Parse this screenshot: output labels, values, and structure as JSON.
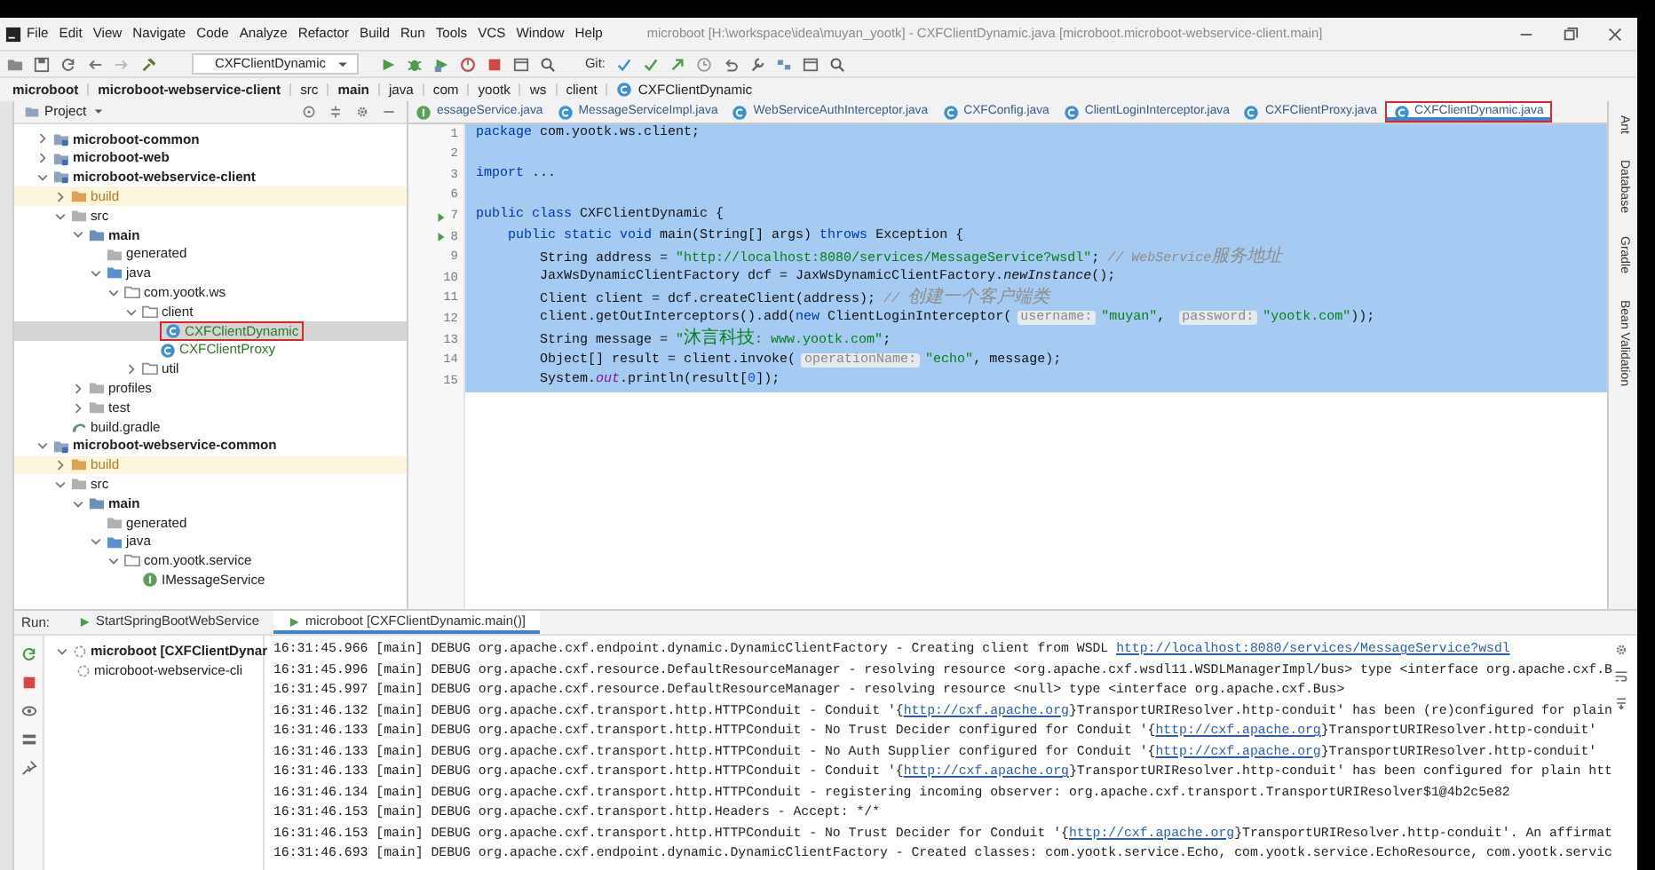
{
  "window": {
    "title": "microboot [H:\\workspace\\idea\\muyan_yootk] - CXFClientDynamic.java [microboot.microboot-webservice-client.main]"
  },
  "menu": [
    "File",
    "Edit",
    "View",
    "Navigate",
    "Code",
    "Analyze",
    "Refactor",
    "Build",
    "Run",
    "Tools",
    "VCS",
    "Window",
    "Help"
  ],
  "toolbar": {
    "run_configuration": "CXFClientDynamic",
    "git_label": "Git:"
  },
  "breadcrumb": [
    {
      "label": "microboot",
      "kind": "module"
    },
    {
      "label": "microboot-webservice-client",
      "kind": "module"
    },
    {
      "label": "src",
      "kind": "folder"
    },
    {
      "label": "main",
      "kind": "module"
    },
    {
      "label": "java",
      "kind": "folder"
    },
    {
      "label": "com",
      "kind": "folder"
    },
    {
      "label": "yootk",
      "kind": "folder"
    },
    {
      "label": "ws",
      "kind": "folder"
    },
    {
      "label": "client",
      "kind": "folder"
    },
    {
      "label": "CXFClientDynamic",
      "kind": "class"
    }
  ],
  "project_panel": {
    "title": "Project",
    "tree": [
      {
        "label": "microboot-common",
        "kind": "module",
        "expanded": false,
        "selected": false
      },
      {
        "label": "microboot-web",
        "kind": "module",
        "expanded": false,
        "selected": false
      },
      {
        "label": "microboot-webservice-client",
        "kind": "module",
        "expanded": true,
        "selected": false,
        "children": [
          {
            "label": "build",
            "kind": "excluded",
            "expanded": false,
            "selected": false
          },
          {
            "label": "src",
            "kind": "folder",
            "expanded": true,
            "selected": false,
            "children": [
              {
                "label": "main",
                "kind": "source-root",
                "expanded": true,
                "selected": false,
                "children": [
                  {
                    "label": "generated",
                    "kind": "folder",
                    "selected": false
                  },
                  {
                    "label": "java",
                    "kind": "source-folder",
                    "expanded": true,
                    "selected": false,
                    "children": [
                      {
                        "label": "com.yootk.ws",
                        "kind": "package",
                        "expanded": true,
                        "selected": false,
                        "children": [
                          {
                            "label": "client",
                            "kind": "package",
                            "expanded": true,
                            "selected": false,
                            "children": [
                              {
                                "label": "CXFClientDynamic",
                                "kind": "class",
                                "selected": true,
                                "highlighted": true
                              },
                              {
                                "label": "CXFClientProxy",
                                "kind": "class",
                                "selected": false
                              }
                            ]
                          },
                          {
                            "label": "util",
                            "kind": "package",
                            "expanded": false,
                            "selected": false
                          }
                        ]
                      }
                    ]
                  }
                ]
              },
              {
                "label": "profiles",
                "kind": "folder",
                "expanded": false,
                "selected": false
              },
              {
                "label": "test",
                "kind": "folder",
                "expanded": false,
                "selected": false
              }
            ]
          },
          {
            "label": "build.gradle",
            "kind": "gradle",
            "selected": false
          }
        ]
      },
      {
        "label": "microboot-webservice-common",
        "kind": "module",
        "expanded": true,
        "selected": false,
        "children": [
          {
            "label": "build",
            "kind": "excluded",
            "expanded": false,
            "selected": false
          },
          {
            "label": "src",
            "kind": "folder",
            "expanded": true,
            "selected": false,
            "children": [
              {
                "label": "main",
                "kind": "source-root",
                "expanded": true,
                "selected": false,
                "children": [
                  {
                    "label": "generated",
                    "kind": "folder",
                    "selected": false
                  },
                  {
                    "label": "java",
                    "kind": "source-folder",
                    "expanded": true,
                    "selected": false,
                    "children": [
                      {
                        "label": "com.yootk.service",
                        "kind": "package",
                        "expanded": true,
                        "selected": false,
                        "children": [
                          {
                            "label": "IMessageService",
                            "kind": "interface",
                            "selected": false
                          }
                        ]
                      }
                    ]
                  }
                ]
              }
            ]
          }
        ]
      }
    ]
  },
  "editor": {
    "tabs": [
      {
        "label": "essageService.java",
        "kind": "interface",
        "selected": false
      },
      {
        "label": "MessageServiceImpl.java",
        "kind": "class",
        "selected": false
      },
      {
        "label": "WebServiceAuthInterceptor.java",
        "kind": "class",
        "selected": false
      },
      {
        "label": "CXFConfig.java",
        "kind": "class",
        "selected": false
      },
      {
        "label": "ClientLoginInterceptor.java",
        "kind": "class",
        "selected": false
      },
      {
        "label": "CXFClientProxy.java",
        "kind": "class",
        "selected": false
      },
      {
        "label": "CXFClientDynamic.java",
        "kind": "class",
        "selected": true,
        "highlighted": true
      }
    ],
    "code_lines": [
      {
        "number": "1",
        "selected": true,
        "segments": [
          {
            "kind": "keyword",
            "text": "package"
          },
          {
            "kind": "plain",
            "text": " com.yootk.ws.client;"
          }
        ]
      },
      {
        "number": "2",
        "selected": true
      },
      {
        "number": "3",
        "selected": true,
        "segments": [
          {
            "kind": "keyword",
            "text": "import"
          },
          {
            "kind": "plain",
            "text": " ..."
          }
        ]
      },
      {
        "number": "6",
        "selected": true
      },
      {
        "number": "7",
        "run_marker": true,
        "selected": true,
        "segments": [
          {
            "kind": "keyword",
            "text": "public class"
          },
          {
            "kind": "plain",
            "text": " CXFClientDynamic {"
          }
        ]
      },
      {
        "number": "8",
        "run_marker": true,
        "selected": true,
        "segments": [
          {
            "kind": "keyword",
            "text": "    public static void"
          },
          {
            "kind": "plain",
            "text": " main(String[] args) "
          },
          {
            "kind": "keyword",
            "text": "throws"
          },
          {
            "kind": "plain",
            "text": " Exception {"
          }
        ]
      },
      {
        "number": "9",
        "selected": true,
        "segments": [
          {
            "kind": "plain",
            "text": "        String address = "
          },
          {
            "kind": "string",
            "text": "\"http://localhost:8080/services/MessageService?wsdl\""
          },
          {
            "kind": "plain",
            "text": "; "
          },
          {
            "kind": "comment",
            "text": "// WebService服务地址"
          }
        ]
      },
      {
        "number": "10",
        "selected": true,
        "segments": [
          {
            "kind": "plain",
            "text": "        JaxWsDynamicClientFactory dcf = JaxWsDynamicClientFactory."
          },
          {
            "kind": "italic",
            "text": "newInstance"
          },
          {
            "kind": "plain",
            "text": "();"
          }
        ]
      },
      {
        "number": "11",
        "selected": true,
        "segments": [
          {
            "kind": "plain",
            "text": "        Client client = dcf.createClient(address); "
          },
          {
            "kind": "comment",
            "text": "// 创建一个客户端类"
          }
        ]
      },
      {
        "number": "12",
        "selected": true,
        "segments": [
          {
            "kind": "plain",
            "text": "        client.getOutInterceptors().add("
          },
          {
            "kind": "keyword",
            "text": "new"
          },
          {
            "kind": "plain",
            "text": " ClientLoginInterceptor("
          },
          {
            "kind": "hint",
            "text": "username:"
          },
          {
            "kind": "string",
            "text": "\"muyan\""
          },
          {
            "kind": "plain",
            "text": ", "
          },
          {
            "kind": "hint",
            "text": "password:"
          },
          {
            "kind": "string",
            "text": "\"yootk.com\""
          },
          {
            "kind": "plain",
            "text": "));"
          }
        ]
      },
      {
        "number": "13",
        "selected": true,
        "segments": [
          {
            "kind": "plain",
            "text": "        String message = "
          },
          {
            "kind": "string",
            "text": "\"沐言科技: www.yootk.com\""
          },
          {
            "kind": "plain",
            "text": ";"
          }
        ]
      },
      {
        "number": "14",
        "selected": true,
        "segments": [
          {
            "kind": "plain",
            "text": "        Object[] result = client.invoke("
          },
          {
            "kind": "hint",
            "text": "operationName:"
          },
          {
            "kind": "string",
            "text": "\"echo\""
          },
          {
            "kind": "plain",
            "text": ", message);"
          }
        ]
      },
      {
        "number": "15",
        "selected": true,
        "segments": [
          {
            "kind": "plain",
            "text": "        System."
          },
          {
            "kind": "field",
            "text": "out"
          },
          {
            "kind": "plain",
            "text": ".println(result["
          },
          {
            "kind": "number",
            "text": "0"
          },
          {
            "kind": "plain",
            "text": "]);"
          }
        ]
      }
    ]
  },
  "right_tool_strip": [
    "Ant",
    "Database",
    "Gradle",
    "Bean Validation"
  ],
  "run_panel": {
    "label": "Run:",
    "tabs": [
      {
        "label": "StartSpringBootWebService",
        "selected": false
      },
      {
        "label": "microboot [CXFClientDynamic.main()]",
        "selected": true
      }
    ],
    "tree": [
      {
        "label": "microboot [CXFClientDynar",
        "expanded": true,
        "children": [
          {
            "label": "microboot-webservice-cli"
          }
        ]
      }
    ],
    "console": [
      {
        "segments": [
          {
            "kind": "text",
            "text": "16:31:45.966 [main] DEBUG org.apache.cxf.endpoint.dynamic.DynamicClientFactory - Creating client from WSDL "
          },
          {
            "kind": "link",
            "text": "http://localhost:8080/services/MessageService?wsdl"
          }
        ]
      },
      {
        "segments": [
          {
            "kind": "text",
            "text": "16:31:45.996 [main] DEBUG org.apache.cxf.resource.DefaultResourceManager - resolving resource <org.apache.cxf.wsdl11.WSDLManagerImpl/bus> type <interface org.apache.cxf.B"
          }
        ]
      },
      {
        "segments": [
          {
            "kind": "text",
            "text": "16:31:45.997 [main] DEBUG org.apache.cxf.resource.DefaultResourceManager - resolving resource <null> type <interface org.apache.cxf.Bus>"
          }
        ]
      },
      {
        "segments": [
          {
            "kind": "text",
            "text": "16:31:46.132 [main] DEBUG org.apache.cxf.transport.http.HTTPConduit - Conduit '{"
          },
          {
            "kind": "link",
            "text": "http://cxf.apache.org"
          },
          {
            "kind": "text",
            "text": "}TransportURIResolver.http-conduit' has been (re)configured for plain"
          }
        ]
      },
      {
        "segments": [
          {
            "kind": "text",
            "text": "16:31:46.133 [main] DEBUG org.apache.cxf.transport.http.HTTPConduit - No Trust Decider configured for Conduit '{"
          },
          {
            "kind": "link",
            "text": "http://cxf.apache.org"
          },
          {
            "kind": "text",
            "text": "}TransportURIResolver.http-conduit'"
          }
        ]
      },
      {
        "segments": [
          {
            "kind": "text",
            "text": "16:31:46.133 [main] DEBUG org.apache.cxf.transport.http.HTTPConduit - No Auth Supplier configured for Conduit '{"
          },
          {
            "kind": "link",
            "text": "http://cxf.apache.org"
          },
          {
            "kind": "text",
            "text": "}TransportURIResolver.http-conduit'"
          }
        ]
      },
      {
        "segments": [
          {
            "kind": "text",
            "text": "16:31:46.133 [main] DEBUG org.apache.cxf.transport.http.HTTPConduit - Conduit '{"
          },
          {
            "kind": "link",
            "text": "http://cxf.apache.org"
          },
          {
            "kind": "text",
            "text": "}TransportURIResolver.http-conduit' has been configured for plain htt"
          }
        ]
      },
      {
        "segments": [
          {
            "kind": "text",
            "text": "16:31:46.134 [main] DEBUG org.apache.cxf.transport.http.HTTPConduit - registering incoming observer: org.apache.cxf.transport.TransportURIResolver$1@4b2c5e82"
          }
        ]
      },
      {
        "segments": [
          {
            "kind": "text",
            "text": "16:31:46.153 [main] DEBUG org.apache.cxf.transport.http.Headers - Accept: */*"
          }
        ]
      },
      {
        "segments": [
          {
            "kind": "text",
            "text": "16:31:46.153 [main] DEBUG org.apache.cxf.transport.http.HTTPConduit - No Trust Decider for Conduit '{"
          },
          {
            "kind": "link",
            "text": "http://cxf.apache.org"
          },
          {
            "kind": "text",
            "text": "}TransportURIResolver.http-conduit'. An affirmat"
          }
        ]
      },
      {
        "segments": [
          {
            "kind": "text",
            "text": "16:31:46.693 [main] DEBUG org.apache.cxf.endpoint.dynamic.DynamicClientFactory - Created classes: com.yootk.service.Echo, com.yootk.service.EchoResource, com.yootk.servic"
          }
        ]
      }
    ]
  }
}
